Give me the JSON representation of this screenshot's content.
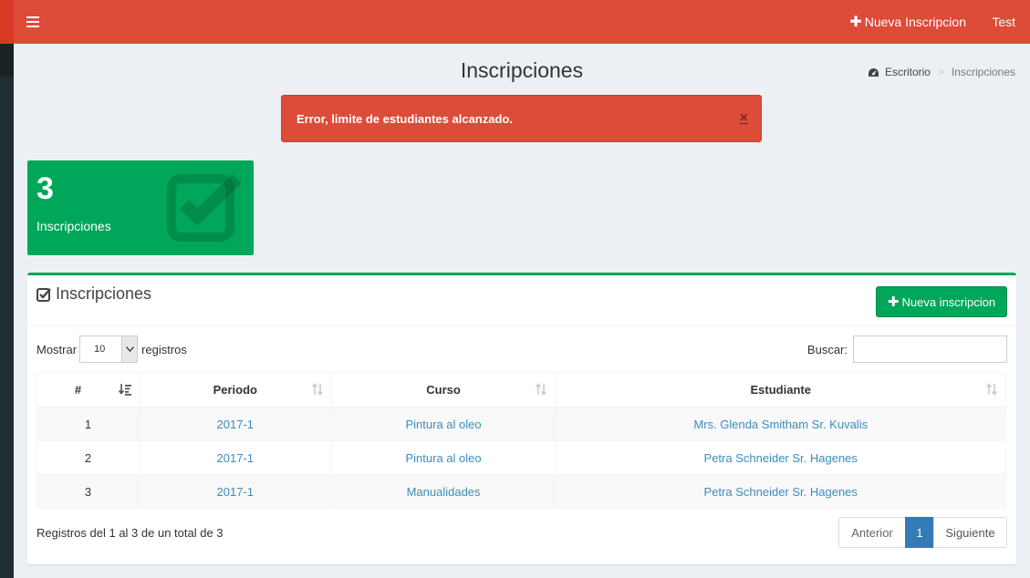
{
  "topbar": {
    "new_label": "Nueva Inscripcion",
    "user_label": "Test"
  },
  "page": {
    "title": "Inscripciones"
  },
  "breadcrumb": {
    "home": "Escritorio",
    "separator": ">",
    "current": "Inscripciones"
  },
  "alert": {
    "message": "Error, limite de estudiantes alcanzado.",
    "close": "×"
  },
  "stat": {
    "count": "3",
    "label": "Inscripciones"
  },
  "box": {
    "title": "Inscripciones",
    "new_button": "Nueva inscripcion"
  },
  "table_controls": {
    "show_label": "Mostrar",
    "page_size": "10",
    "records_label": "registros",
    "search_label": "Buscar:"
  },
  "table": {
    "columns": [
      "#",
      "Periodo",
      "Curso",
      "Estudiante"
    ],
    "rows": [
      {
        "num": "1",
        "periodo": "2017-1",
        "curso": "Pintura al oleo",
        "estudiante": "Mrs. Glenda Smitham Sr. Kuvalis"
      },
      {
        "num": "2",
        "periodo": "2017-1",
        "curso": "Pintura al oleo",
        "estudiante": "Petra Schneider Sr. Hagenes"
      },
      {
        "num": "3",
        "periodo": "2017-1",
        "curso": "Manualidades",
        "estudiante": "Petra Schneider Sr. Hagenes"
      }
    ]
  },
  "footer": {
    "info": "Registros del 1 al 3 de un total de 3",
    "prev": "Anterior",
    "current_page": "1",
    "next": "Siguiente"
  },
  "colors": {
    "header": "#dd4b39",
    "success": "#00a65a",
    "link": "#3c8dbc",
    "page_active": "#337ab7"
  }
}
